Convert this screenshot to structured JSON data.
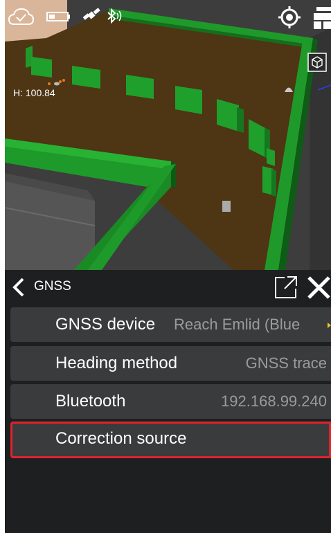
{
  "viewport": {
    "height_label": "H: 100.84",
    "icons": [
      "cloud-check-icon",
      "battery-icon",
      "satellite-icon",
      "bluetooth-icon",
      "locate-icon",
      "layers-icon",
      "3d-cube-icon"
    ]
  },
  "panel": {
    "title": "GNSS",
    "rows": [
      {
        "label": "GNSS device",
        "value": "Reach Emlid (Blue"
      },
      {
        "label": "Heading method",
        "value": "GNSS trace"
      },
      {
        "label": "Bluetooth",
        "value": "192.168.99.240"
      },
      {
        "label": "Correction source",
        "value": ""
      }
    ],
    "selected_row": "Correction source"
  },
  "colors": {
    "accent": "#e0232e",
    "panel_bg": "#1e1f21",
    "row_bg": "#3a3b3d",
    "value_text": "#9b9b9b",
    "wall_green": "#1f9a2a",
    "ground_brown": "#4e3514"
  }
}
